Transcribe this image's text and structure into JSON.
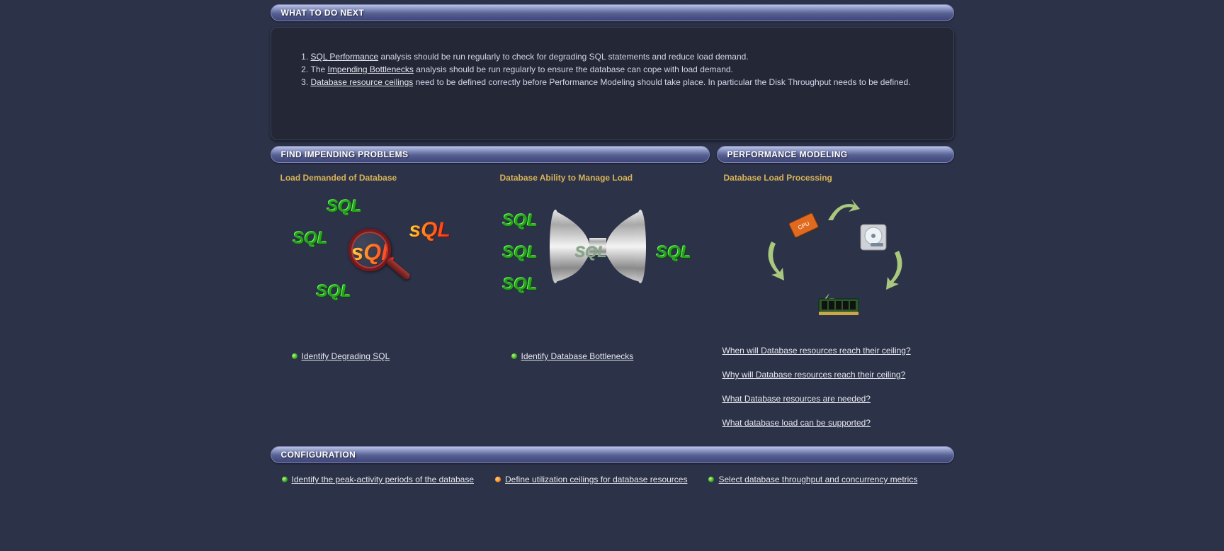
{
  "sections": {
    "next": {
      "title": "WHAT TO DO NEXT",
      "items": [
        {
          "link": "SQL Performance",
          "after": " analysis should be run regularly to check for degrading SQL statements and reduce load demand."
        },
        {
          "before": "The ",
          "link": "Impending Bottlenecks",
          "after": " analysis should be run regularly to ensure the database can cope with load demand."
        },
        {
          "link": "Database resource ceilings",
          "after": " need to be defined correctly before Performance Modeling should take place. In particular the Disk Throughput needs to be defined."
        }
      ]
    },
    "find": {
      "title": "FIND IMPENDING PROBLEMS",
      "load_demand": {
        "heading": "Load Demanded of Database",
        "link": "Identify Degrading SQL"
      },
      "ability": {
        "heading": "Database Ability to Manage Load",
        "link": "Identify Database Bottlenecks"
      }
    },
    "model": {
      "title": "PERFORMANCE MODELING",
      "heading": "Database Load Processing",
      "questions": [
        "When will Database resources reach their ceiling?",
        "Why will Database resources reach their ceiling?",
        "What Database resources are needed?",
        "What database load can be supported?"
      ]
    },
    "config": {
      "title": "CONFIGURATION",
      "links": [
        {
          "text": "Identify the peak-activity periods of the database",
          "bullet": "green"
        },
        {
          "text": "Define utilization ceilings for database resources",
          "bullet": "orange"
        },
        {
          "text": "Select database throughput and concurrency metrics",
          "bullet": "green"
        }
      ]
    }
  },
  "glyphs": {
    "sql": "SQL",
    "sql_lc": "sQL"
  }
}
